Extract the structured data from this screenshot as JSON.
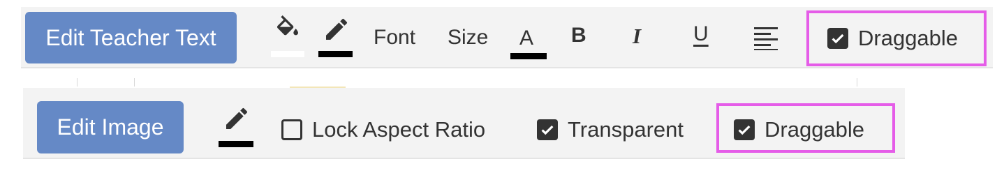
{
  "text_toolbar": {
    "edit_button_label": "Edit Teacher Text",
    "fill_icon": "paint-bucket-icon",
    "pen_icon": "pencil-icon",
    "fill_color": "#ffffff",
    "pen_color": "#000000",
    "font_label": "Font",
    "size_label": "Size",
    "text_color_letter": "A",
    "text_color": "#000000",
    "bold_letter": "B",
    "italic_letter": "I",
    "underline_letter": "U",
    "align_icon": "align-left-icon",
    "draggable_label": "Draggable",
    "draggable_checked": true
  },
  "image_toolbar": {
    "edit_button_label": "Edit Image",
    "pen_icon": "pencil-icon",
    "pen_color": "#000000",
    "lock_aspect_label": "Lock Aspect Ratio",
    "lock_aspect_checked": false,
    "transparent_label": "Transparent",
    "transparent_checked": true,
    "draggable_label": "Draggable",
    "draggable_checked": true
  },
  "colors": {
    "button_bg": "#6589c6",
    "toolbar_bg": "#f3f3f3",
    "highlight": "#e55ce8",
    "icon": "#333333"
  }
}
